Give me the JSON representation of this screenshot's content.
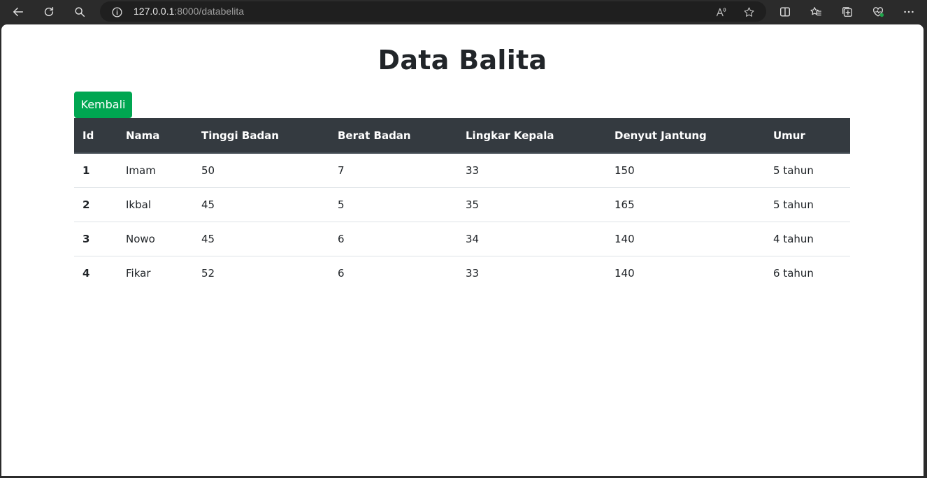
{
  "browser": {
    "url_host": "127.0.0.1",
    "url_path": ":8000/databelita"
  },
  "page": {
    "title": "Data Balita",
    "back_label": "Kembali"
  },
  "table": {
    "headers": [
      "Id",
      "Nama",
      "Tinggi Badan",
      "Berat Badan",
      "Lingkar Kepala",
      "Denyut Jantung",
      "Umur"
    ],
    "rows": [
      [
        "1",
        "Imam",
        "50",
        "7",
        "33",
        "150",
        "5 tahun"
      ],
      [
        "2",
        "Ikbal",
        "45",
        "5",
        "35",
        "165",
        "5 tahun"
      ],
      [
        "3",
        "Nowo",
        "45",
        "6",
        "34",
        "140",
        "4 tahun"
      ],
      [
        "4",
        "Fikar",
        "52",
        "6",
        "33",
        "140",
        "6 tahun"
      ]
    ]
  },
  "colors": {
    "chrome_bg": "#2b2b2b",
    "header_bg": "#343a40",
    "button_bg": "#00a651"
  }
}
